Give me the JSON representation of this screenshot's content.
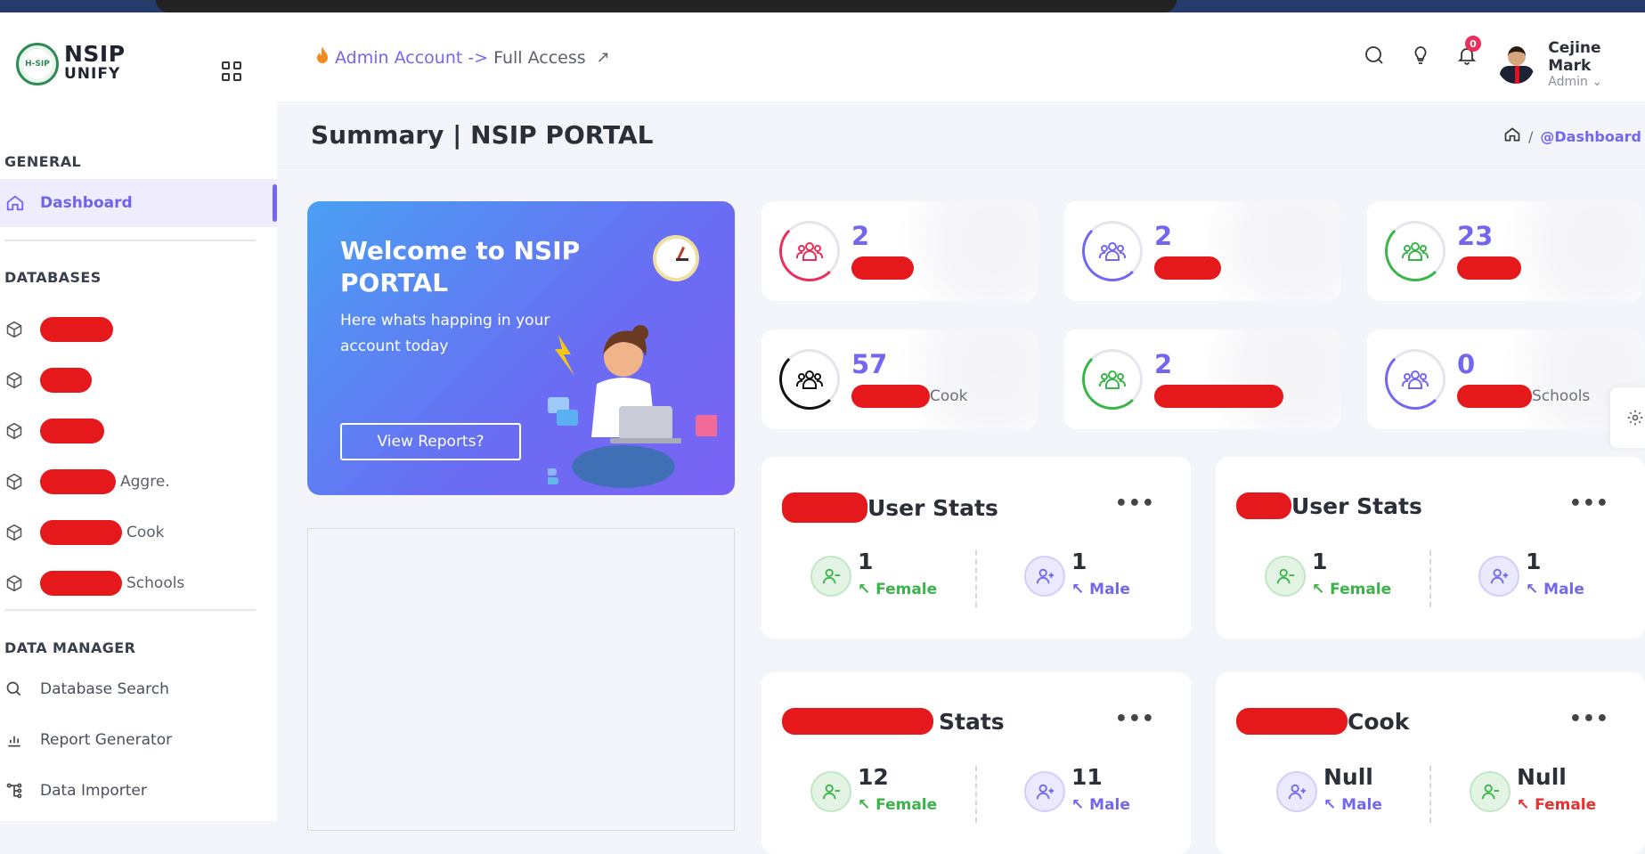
{
  "app": {
    "logo_line1": "NSIP",
    "logo_line2": "UNIFY",
    "logo_badge": "H-SIP"
  },
  "sidebar": {
    "general_title": "GENERAL",
    "dashboard_label": "Dashboard",
    "databases_title": "DATABASES",
    "databases": [
      {
        "suffix": ""
      },
      {
        "suffix": ""
      },
      {
        "suffix": ""
      },
      {
        "suffix": "Aggre."
      },
      {
        "suffix": "Cook"
      },
      {
        "suffix": "Schools"
      }
    ],
    "data_manager_title": "DATA MANAGER",
    "data_manager_items": [
      {
        "label": "Database Search"
      },
      {
        "label": "Report Generator"
      },
      {
        "label": "Data Importer"
      }
    ]
  },
  "header": {
    "account_link": "Admin Account",
    "arrow": "->",
    "access": "Full Access",
    "notif_count": "0",
    "user_name": "Cejine Mark",
    "user_role": "Admin"
  },
  "page": {
    "title": "Summary | NSIP PORTAL",
    "breadcrumb_current": "@Dashboard",
    "breadcrumb_sep": "/"
  },
  "welcome": {
    "heading": "Welcome to NSIP PORTAL",
    "text": "Here whats happing in your account today",
    "button": "View Reports?"
  },
  "stats": [
    {
      "value": "2",
      "suffix": "",
      "color": "#ea2f5d"
    },
    {
      "value": "2",
      "suffix": "",
      "color": "#7367f0"
    },
    {
      "value": "23",
      "suffix": "",
      "color": "#3ab54a"
    },
    {
      "value": "57",
      "suffix": "Cook",
      "color": "#111111"
    },
    {
      "value": "2",
      "suffix": "",
      "color": "#3ab54a"
    },
    {
      "value": "0",
      "suffix": "Schools",
      "color": "#7367f0"
    }
  ],
  "user_stats": [
    {
      "title": "User Stats",
      "dots": "•••",
      "a_num": "1",
      "a_tag": "Female",
      "b_num": "1",
      "b_tag": "Male"
    },
    {
      "title": "User Stats",
      "dots": "•••",
      "a_num": "1",
      "a_tag": "Female",
      "b_num": "1",
      "b_tag": "Male"
    },
    {
      "title": "Stats",
      "dots": "•••",
      "a_num": "12",
      "a_tag": "Female",
      "b_num": "11",
      "b_tag": "Male"
    },
    {
      "title": "Cook",
      "dots": "•••",
      "a_num": "Null",
      "a_tag": "Male",
      "b_num": "Null",
      "b_tag": "Female"
    }
  ]
}
